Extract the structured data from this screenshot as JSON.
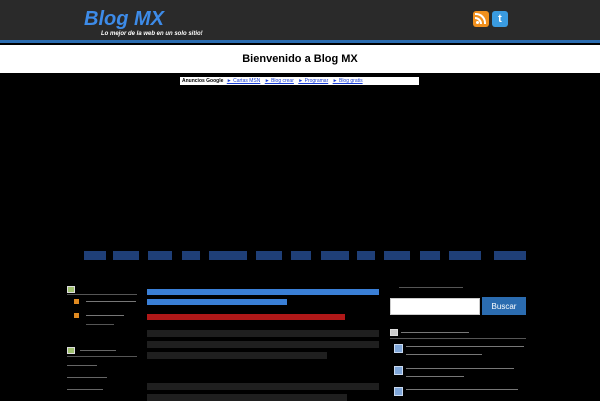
{
  "header": {
    "logo_text": "Blog MX",
    "tagline": "Lo mejor de la web en un solo sitio!",
    "rss_icon": "rss-feed-icon",
    "twitter_icon": "twitter-bird-icon",
    "twitter_glyph": "t"
  },
  "welcome": {
    "text": "Bienvenido a Blog MX"
  },
  "ads_bar": {
    "label": "Anuncios Google",
    "links": [
      "► Cartas MSN",
      "► Blog crear",
      "► Programar",
      "► Blog gratis"
    ]
  },
  "colors": {
    "accent": "#2b6cb0",
    "logo": "#3d8be8",
    "link": "#3a7fd6",
    "post_meta": "#e01818"
  },
  "search": {
    "value": "",
    "button_label": "Buscar"
  }
}
